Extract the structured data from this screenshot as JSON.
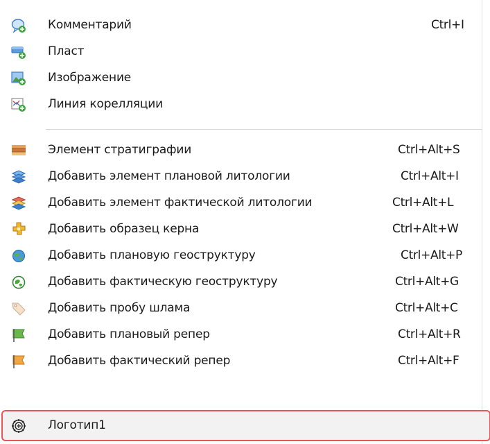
{
  "menu": {
    "items": [
      {
        "label": "Комментарий",
        "shortcut": "Ctrl+I",
        "icon": "comment-bubble-add-icon"
      },
      {
        "label": "Пласт",
        "shortcut": "",
        "icon": "layer-add-icon"
      },
      {
        "label": "Изображение",
        "shortcut": "",
        "icon": "image-add-icon"
      },
      {
        "label": "Линия корелляции",
        "shortcut": "",
        "icon": "correlation-line-add-icon"
      },
      {
        "label": "Элемент стратиграфии",
        "shortcut": "Ctrl+Alt+S",
        "icon": "stratigraphy-icon"
      },
      {
        "label": "Добавить элемент плановой литологии",
        "shortcut": "Ctrl+Alt+I",
        "icon": "planned-lithology-icon"
      },
      {
        "label": "Добавить элемент фактической литологии",
        "shortcut": "Ctrl+Alt+L",
        "icon": "actual-lithology-icon"
      },
      {
        "label": "Добавить образец керна",
        "shortcut": "Ctrl+Alt+W",
        "icon": "core-sample-icon"
      },
      {
        "label": "Добавить плановую геоструктуру",
        "shortcut": "Ctrl+Alt+P",
        "icon": "planned-geostructure-icon"
      },
      {
        "label": "Добавить фактическую геоструктуру",
        "shortcut": "Ctrl+Alt+G",
        "icon": "actual-geostructure-icon"
      },
      {
        "label": "Добавить пробу шлама",
        "shortcut": "Ctrl+Alt+C",
        "icon": "cuttings-sample-tag-icon"
      },
      {
        "label": "Добавить плановый репер",
        "shortcut": "Ctrl+Alt+R",
        "icon": "planned-marker-flag-icon"
      },
      {
        "label": "Добавить фактический репер",
        "shortcut": "Ctrl+Alt+F",
        "icon": "actual-marker-flag-icon"
      },
      {
        "label": "Логотип1",
        "shortcut": "",
        "icon": "logo-gear-icon"
      }
    ],
    "highlight_color": "#e8565a"
  }
}
